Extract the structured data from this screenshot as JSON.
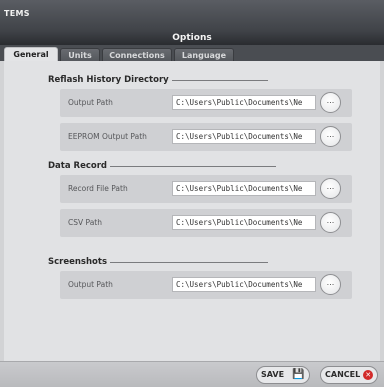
{
  "app": {
    "title": "TEMS"
  },
  "dialog": {
    "title": "Options"
  },
  "tabs": [
    {
      "label": "General",
      "active": true
    },
    {
      "label": "Units",
      "active": false
    },
    {
      "label": "Connections",
      "active": false
    },
    {
      "label": "Language",
      "active": false
    }
  ],
  "groups": {
    "reflash": {
      "title": "Reflash History Directory",
      "rows": [
        {
          "label": "Output Path",
          "value": "C:\\Users\\Public\\Documents\\Ne"
        },
        {
          "label": "EEPROM Output Path",
          "value": "C:\\Users\\Public\\Documents\\Ne"
        }
      ]
    },
    "data_record": {
      "title": "Data Record",
      "rows": [
        {
          "label": "Record File Path",
          "value": "C:\\Users\\Public\\Documents\\Ne"
        },
        {
          "label": "CSV Path",
          "value": "C:\\Users\\Public\\Documents\\Ne"
        }
      ]
    },
    "screenshots": {
      "title": "Screenshots",
      "rows": [
        {
          "label": "Output Path",
          "value": "C:\\Users\\Public\\Documents\\Ne"
        }
      ]
    }
  },
  "browse_label": "...",
  "buttons": {
    "save": "SAVE",
    "cancel": "CANCEL"
  },
  "icons": {
    "save": "floppy-disk-icon",
    "cancel": "close-circle-icon",
    "browse": "ellipsis-icon"
  },
  "colors": {
    "accent": "#d22a2a",
    "titlebar": "#3f4247",
    "panel": "#e1e2e4"
  }
}
